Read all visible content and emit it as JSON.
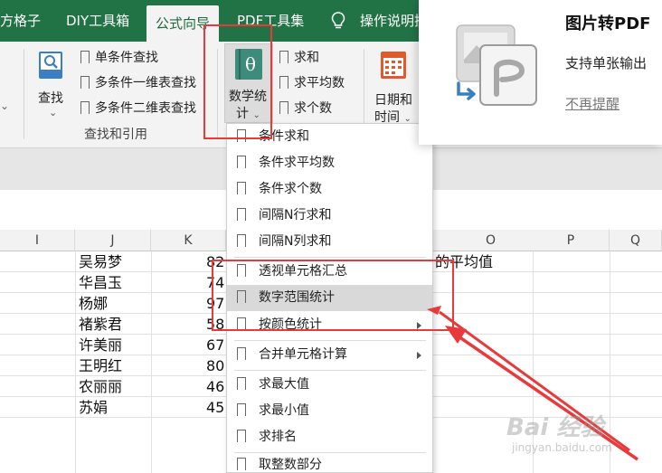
{
  "tabs": [
    "方格子",
    "DIY工具箱",
    "公式向导",
    "PDF工具集",
    "操作说明搜"
  ],
  "ribbon": {
    "lookup_label": "查找",
    "lookup_items": [
      "单条件查找",
      "多条件一维表查找",
      "多条件二维表查找"
    ],
    "group_label": "查找和引用",
    "stats_label_line1": "数学统",
    "stats_label_line2": "计",
    "stats_icon_glyph": "θ",
    "sum_items": [
      "求和",
      "求平均数",
      "求个数"
    ],
    "date_label_line1": "日期和",
    "date_label_line2": "时间"
  },
  "grid": {
    "columns": [
      "I",
      "J",
      "K",
      "O",
      "P",
      "Q"
    ],
    "names": [
      "吴易梦",
      "华昌玉",
      "杨娜",
      "褚紫君",
      "许美丽",
      "王明红",
      "农丽丽",
      "苏娟"
    ],
    "values": [
      "82",
      "74",
      "97",
      "58",
      "67",
      "80",
      "46",
      "45"
    ],
    "note_text": "的平均值"
  },
  "dropdown": {
    "items": [
      "条件求和",
      "条件求平均数",
      "条件求个数",
      "间隔N行求和",
      "间隔N列求和",
      "透视单元格汇总",
      "数字范围统计",
      "按颜色统计",
      "合并单元格计算",
      "求最大值",
      "求最小值",
      "求排名",
      "取整数部分"
    ],
    "highlighted": "数字范围统计"
  },
  "popup": {
    "title": "图片转PDF",
    "description": "支持单张输出",
    "dismiss": "不再提醒"
  },
  "colors": {
    "tab_green": "#217346",
    "annotation_red": "#e83a3a",
    "icon_blue": "#3a7fc1",
    "icon_teal": "#3d8b7a",
    "icon_orange": "#e05a2b"
  }
}
